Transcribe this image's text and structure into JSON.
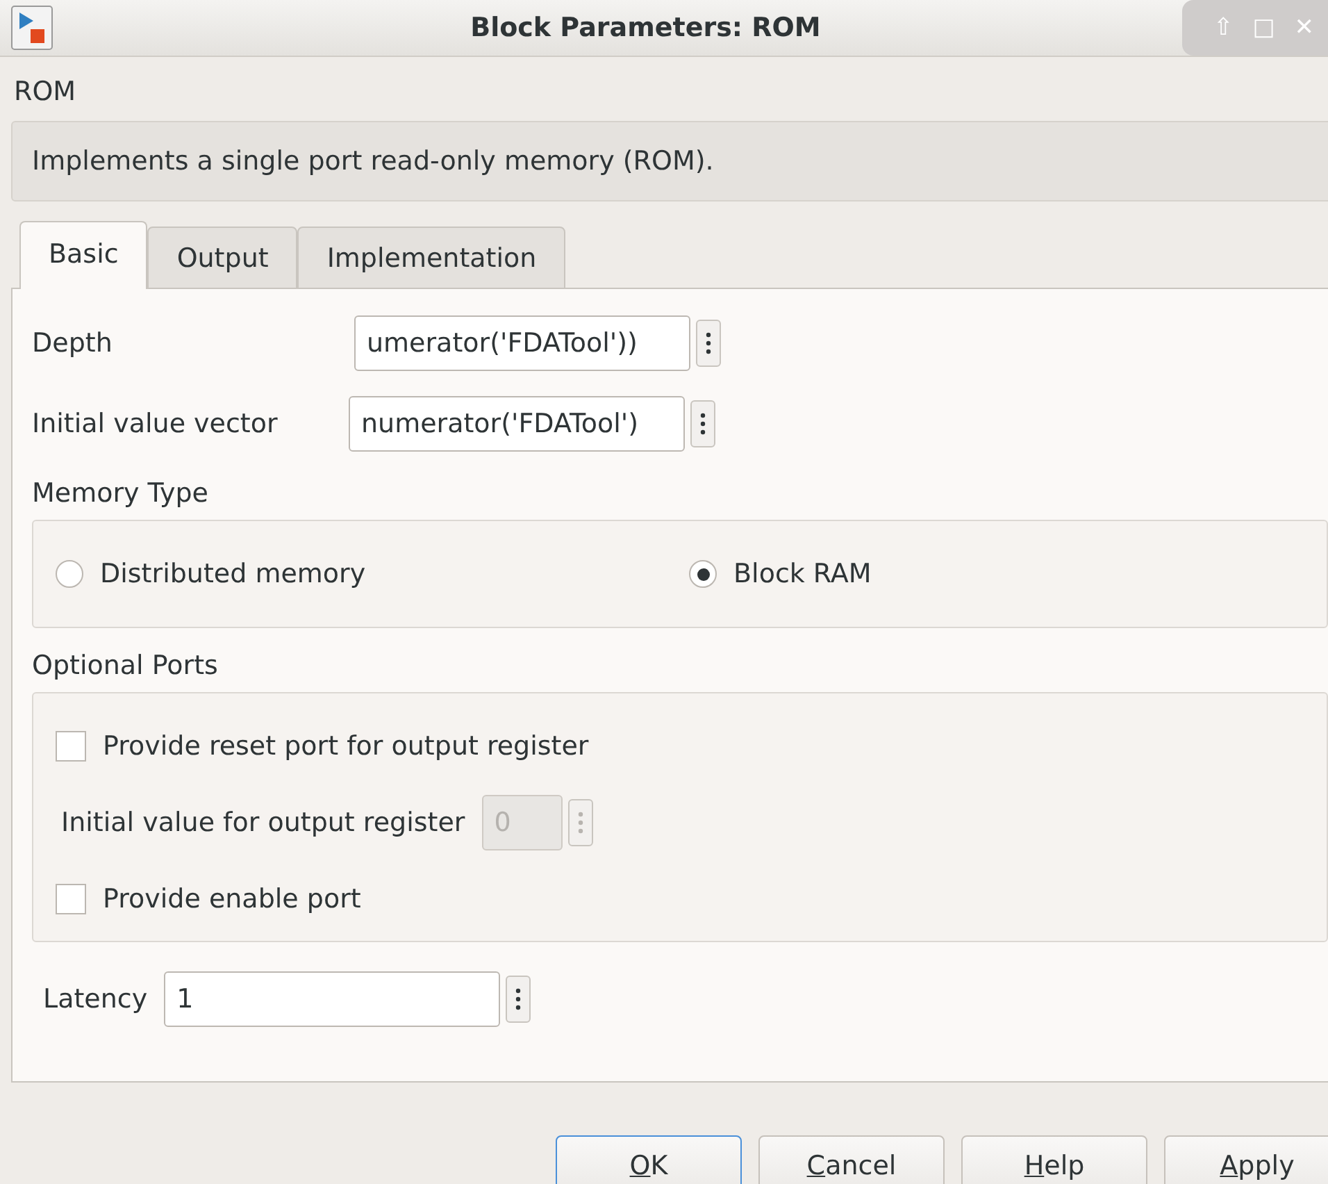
{
  "window": {
    "title": "Block Parameters: ROM",
    "controls": [
      "⇧",
      "□",
      "✕"
    ]
  },
  "block_name": "ROM",
  "description": "Implements a single port read-only memory (ROM).",
  "tabs": [
    {
      "label": "Basic",
      "selected": true
    },
    {
      "label": "Output",
      "selected": false
    },
    {
      "label": "Implementation",
      "selected": false
    }
  ],
  "parameters": [
    {
      "label": "Depth",
      "value": "umerator('FDATool'))"
    },
    {
      "label": "Initial value vector",
      "value": "numerator('FDATool')"
    }
  ],
  "memory_type": {
    "title": "Memory Type",
    "options": [
      {
        "label": "Distributed memory",
        "selected": false
      },
      {
        "label": "Block RAM",
        "selected": true
      }
    ]
  },
  "optional_ports": {
    "title": "Optional Ports",
    "items": [
      {
        "kind": "checkbox",
        "label": "Provide reset port for output register",
        "checked": false
      },
      {
        "kind": "field",
        "label": "Initial value for output register",
        "value": "0",
        "disabled": true
      },
      {
        "kind": "checkbox",
        "label": "Provide enable port",
        "checked": false
      }
    ]
  },
  "latency": {
    "label": "Latency",
    "value": "1"
  },
  "buttons": [
    {
      "label": "OK",
      "mnemonic_first": true,
      "default": true
    },
    {
      "label": "Cancel",
      "mnemonic_first": true,
      "default": false
    },
    {
      "label": "Help",
      "mnemonic_first": true,
      "default": false
    },
    {
      "label": "Apply",
      "mnemonic_first": true,
      "default": false
    }
  ]
}
